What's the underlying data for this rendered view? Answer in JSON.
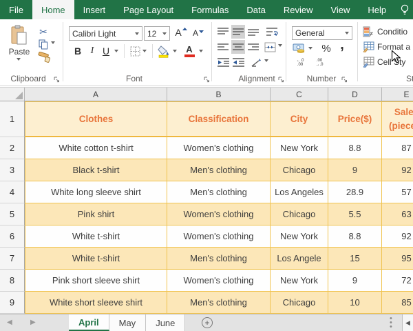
{
  "colors": {
    "excel_green": "#217346",
    "gold_border": "#F0C34F",
    "header_fill": "#FDEFD0",
    "band_fill": "#FCE7B8",
    "header_text": "#E8743A"
  },
  "ribbon_tabs": {
    "items": [
      {
        "label": "File"
      },
      {
        "label": "Home"
      },
      {
        "label": "Insert"
      },
      {
        "label": "Page Layout"
      },
      {
        "label": "Formulas"
      },
      {
        "label": "Data"
      },
      {
        "label": "Review"
      },
      {
        "label": "View"
      },
      {
        "label": "Help"
      }
    ]
  },
  "ribbon": {
    "clipboard": {
      "paste": "Paste",
      "label": "Clipboard"
    },
    "font": {
      "name": "Calibri Light",
      "size": "12",
      "grow": "A",
      "shrink": "A",
      "bold": "B",
      "italic": "I",
      "underline": "U",
      "fontcolor": "A",
      "label": "Font"
    },
    "alignment": {
      "label": "Alignment"
    },
    "number": {
      "format": "General",
      "percent": "%",
      "comma": ",",
      "inc_top": "←.0",
      "inc_bot": ".00",
      "dec_top": ".00",
      "dec_bot": "→.0",
      "label": "Number"
    },
    "styles": {
      "conditional": "Conditio",
      "format_as_table": "Format a",
      "cell_styles": "Cell Sty",
      "label": "Styles"
    }
  },
  "grid": {
    "columns": [
      "A",
      "B",
      "C",
      "D",
      "E"
    ],
    "header_row": {
      "num": "1",
      "clothes": "Clothes",
      "classification": "Classification",
      "city": "City",
      "price": "Price($)",
      "sales_line1": "Sales",
      "sales_line2": "(pieces)"
    },
    "rows": [
      {
        "num": "2",
        "clothes": "White cotton t-shirt",
        "classification": "Women's clothing",
        "city": "New York",
        "price": "8.8",
        "sales": "87"
      },
      {
        "num": "3",
        "clothes": "Black t-shirt",
        "classification": "Men's clothing",
        "city": "Chicago",
        "price": "9",
        "sales": "92"
      },
      {
        "num": "4",
        "clothes": "White long sleeve shirt",
        "classification": "Men's clothing",
        "city": "Los Angeles",
        "price": "28.9",
        "sales": "57"
      },
      {
        "num": "5",
        "clothes": "Pink shirt",
        "classification": "Women's clothing",
        "city": "Chicago",
        "price": "5.5",
        "sales": "63"
      },
      {
        "num": "6",
        "clothes": "White t-shirt",
        "classification": "Women's clothing",
        "city": "New York",
        "price": "8.8",
        "sales": "92"
      },
      {
        "num": "7",
        "clothes": "White t-shirt",
        "classification": "Men's clothing",
        "city": "Los Angele",
        "price": "15",
        "sales": "95"
      },
      {
        "num": "8",
        "clothes": "Pink short sleeve shirt",
        "classification": "Women's clothing",
        "city": "New York",
        "price": "9",
        "sales": "72"
      },
      {
        "num": "9",
        "clothes": "White short sleeve shirt",
        "classification": "Men's clothing",
        "city": "Chicago",
        "price": "10",
        "sales": "85"
      }
    ]
  },
  "sheet_bar": {
    "tabs": [
      {
        "label": "April"
      },
      {
        "label": "May"
      },
      {
        "label": "June"
      }
    ],
    "add": "+"
  }
}
